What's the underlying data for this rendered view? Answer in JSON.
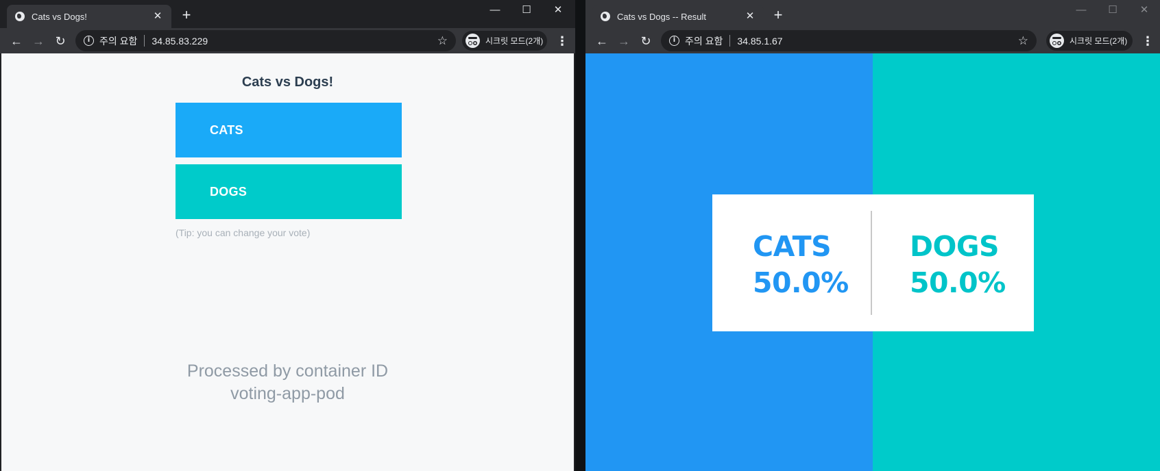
{
  "left_window": {
    "tab": {
      "title": "Cats vs Dogs!",
      "close": "✕"
    },
    "new_tab": "+",
    "window_controls": {
      "minimize": "—",
      "maximize": "☐",
      "close": "✕"
    },
    "toolbar": {
      "back": "←",
      "forward": "→",
      "reload": "↻",
      "security_label": "주의 요함",
      "url": "34.85.83.229",
      "star": "☆",
      "incognito_label": "시크릿 모드(2개)",
      "menu": "⋮"
    },
    "page": {
      "title": "Cats vs Dogs!",
      "option_a": "CATS",
      "option_b": "DOGS",
      "tip": "(Tip: you can change your vote)",
      "processed_line1": "Processed by container ID",
      "processed_line2": "voting-app-pod"
    }
  },
  "right_window": {
    "tab": {
      "title": "Cats vs Dogs -- Result",
      "close": "✕"
    },
    "new_tab": "+",
    "window_controls": {
      "minimize": "—",
      "maximize": "☐",
      "close": "✕"
    },
    "toolbar": {
      "back": "←",
      "forward": "→",
      "reload": "↻",
      "security_label": "주의 요함",
      "url": "34.85.1.67",
      "star": "☆",
      "incognito_label": "시크릿 모드(2개)",
      "menu": "⋮"
    },
    "page": {
      "cats_label": "CATS",
      "cats_percent": "50.0%",
      "dogs_label": "DOGS",
      "dogs_percent": "50.0%"
    }
  },
  "colors": {
    "cats": "#2196f3",
    "dogs": "#00cbca",
    "cats_button": "#1aaaf8"
  }
}
